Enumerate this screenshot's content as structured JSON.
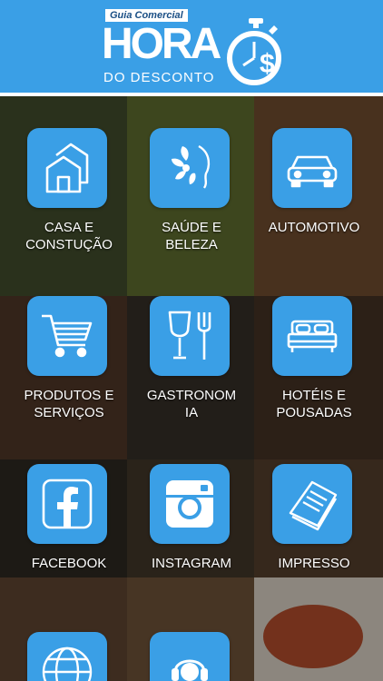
{
  "header": {
    "tag": "Guia Comercial",
    "brand_main": "HORA",
    "brand_sub": "DO DESCONTO",
    "background": "#3a9fe6"
  },
  "tiles": [
    {
      "label": "CASA E\nCONSTUÇÃO",
      "icon": "house-icon"
    },
    {
      "label": "SAÚDE E\nBELEZA",
      "icon": "face-flower-icon"
    },
    {
      "label": "AUTOMOTIVO",
      "icon": "car-icon"
    },
    {
      "label": "PRODUTOS E\nSERVIÇOS",
      "icon": "shopping-cart-icon"
    },
    {
      "label": "GASTRONOM\nIA",
      "icon": "glass-fork-icon"
    },
    {
      "label": "HOTÉIS E\nPOUSADAS",
      "icon": "bed-icon"
    },
    {
      "label": "FACEBOOK",
      "icon": "facebook-icon"
    },
    {
      "label": "INSTAGRAM",
      "icon": "instagram-icon"
    },
    {
      "label": "IMPRESSO",
      "icon": "newspaper-icon"
    },
    {
      "label": "",
      "icon": "www-globe-icon"
    },
    {
      "label": "",
      "icon": "headset-support-icon"
    }
  ],
  "colors": {
    "accent": "#3a9fe6",
    "label": "#ffffff"
  }
}
